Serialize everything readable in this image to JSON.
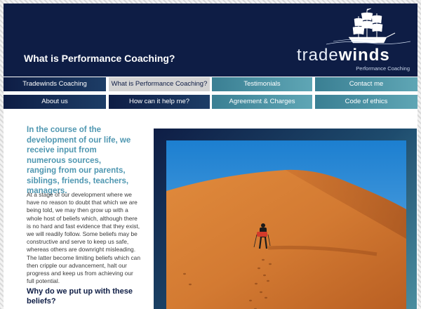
{
  "header": {
    "page_title": "What is Performance Coaching?",
    "logo": {
      "word_light": "trade",
      "word_bold": "winds",
      "tagline": "Performance Coaching"
    }
  },
  "nav": {
    "row1": [
      {
        "label": "Tradewinds Coaching",
        "style": "dark",
        "active": false
      },
      {
        "label": "What is Performance Coaching?",
        "style": "active",
        "active": true
      },
      {
        "label": "Testimonials",
        "style": "teal",
        "active": false
      },
      {
        "label": "Contact me",
        "style": "teal",
        "active": false
      }
    ],
    "row2": [
      {
        "label": "About us",
        "style": "dark",
        "active": false
      },
      {
        "label": "How can it help me?",
        "style": "dark",
        "active": false
      },
      {
        "label": "Agreement & Charges",
        "style": "teal",
        "active": false
      },
      {
        "label": "Code of ethics",
        "style": "teal",
        "active": false
      }
    ]
  },
  "main": {
    "intro": "In the course of the development of our life, we receive input from numerous sources, ranging from our parents, siblings, friends, teachers, managers.",
    "body": "At a stage of our development where we have no reason to doubt that which we are being told, we may then grow up with a whole host of beliefs which, although there is no hard and fast evidence that they exist, we will readily follow. Some beliefs may be constructive and serve to keep us safe, whereas others are downright misleading. The latter become limiting beliefs which can then cripple our advancement, halt our progress and keep us from achieving our full potential.",
    "subheading": "Why do we put up with these beliefs?"
  },
  "colors": {
    "header_bg": "#0e1d45",
    "intro_text": "#4f97b1",
    "teal_nav": "#4a93a5",
    "active_nav": "#d3d3d3"
  },
  "icons": {
    "logo": "sailing-ship-icon",
    "photo": "desert-hiker-photo"
  }
}
